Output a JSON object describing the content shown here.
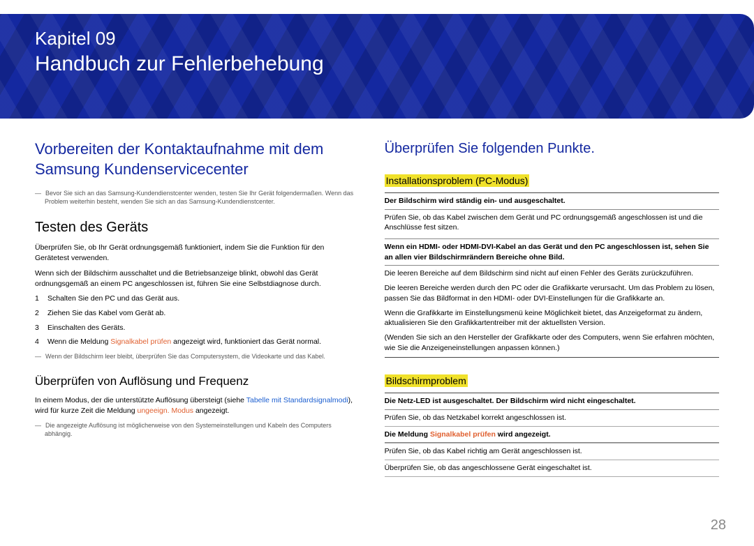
{
  "chapter": "Kapitel 09",
  "title": "Handbuch zur Fehlerbehebung",
  "page_number": "28",
  "left": {
    "heading": "Vorbereiten der Kontaktaufnahme mit dem Samsung Kundenservicecenter",
    "note1": "Bevor Sie sich an das Samsung-Kundendienstcenter wenden, testen Sie Ihr Gerät folgendermaßen. Wenn das Problem weiterhin besteht, wenden Sie sich an das Samsung-Kundendienstcenter.",
    "test_heading": "Testen des Geräts",
    "test_p1": "Überprüfen Sie, ob Ihr Gerät ordnungsgemäß funktioniert, indem Sie die Funktion für den Gerätetest verwenden.",
    "test_p2": "Wenn sich der Bildschirm ausschaltet und die Betriebsanzeige blinkt, obwohl das Gerät ordnungsgemäß an einem PC angeschlossen ist, führen Sie eine Selbstdiagnose durch.",
    "steps": [
      "Schalten Sie den PC und das Gerät aus.",
      "Ziehen Sie das Kabel vom Gerät ab.",
      "Einschalten des Geräts."
    ],
    "step4_pre": "Wenn die Meldung ",
    "step4_red": "Signalkabel prüfen",
    "step4_post": " angezeigt wird, funktioniert das Gerät normal.",
    "note2": "Wenn der Bildschirm leer bleibt, überprüfen Sie das Computersystem, die Videokarte und das Kabel.",
    "freq_heading": "Überprüfen von Auflösung und Frequenz",
    "freq_p_pre": "In einem Modus, der die unterstützte Auflösung übersteigt (siehe ",
    "freq_link": "Tabelle mit Standardsignalmodi",
    "freq_p_mid": "), wird für kurze Zeit die Meldung ",
    "freq_red": "ungeeign. Modus",
    "freq_p_post": " angezeigt.",
    "note3": "Die angezeigte Auflösung ist möglicherweise von den Systemeinstellungen und Kabeln des Computers abhängig."
  },
  "right": {
    "heading": "Überprüfen Sie folgenden Punkte.",
    "section1": {
      "label": "Installationsproblem (PC-Modus)",
      "row1_head": "Der Bildschirm wird ständig ein- und ausgeschaltet.",
      "row1_body": "Prüfen Sie, ob das Kabel zwischen dem Gerät und PC ordnungsgemäß angeschlossen ist und die Anschlüsse fest sitzen.",
      "row2_head": "Wenn ein HDMI- oder HDMI-DVI-Kabel an das Gerät und den PC angeschlossen ist, sehen Sie an allen vier Bildschirmrändern Bereiche ohne Bild.",
      "row2_b1": "Die leeren Bereiche auf dem Bildschirm sind nicht auf einen Fehler des Geräts zurückzuführen.",
      "row2_b2": "Die leeren Bereiche werden durch den PC oder die Grafikkarte verursacht. Um das Problem zu lösen, passen Sie das Bildformat in den HDMI- oder DVI-Einstellungen für die Grafikkarte an.",
      "row2_b3": "Wenn die Grafikkarte im Einstellungsmenü keine Möglichkeit bietet, das Anzeigeformat zu ändern, aktualisieren Sie den Grafikkartentreiber mit der aktuellsten Version.",
      "row2_b4": "(Wenden Sie sich an den Hersteller der Grafikkarte oder des Computers, wenn Sie erfahren möchten, wie Sie die Anzeigeneinstellungen anpassen können.)"
    },
    "section2": {
      "label": "Bildschirmproblem",
      "row1_head": "Die Netz-LED ist ausgeschaltet. Der Bildschirm wird nicht eingeschaltet.",
      "row1_body": "Prüfen Sie, ob das Netzkabel korrekt angeschlossen ist.",
      "row2_head_pre": "Die Meldung ",
      "row2_head_red": "Signalkabel prüfen",
      "row2_head_post": " wird angezeigt.",
      "row2_b1": "Prüfen Sie, ob das Kabel richtig am Gerät angeschlossen ist.",
      "row2_b2": "Überprüfen Sie, ob das angeschlossene Gerät eingeschaltet ist."
    }
  }
}
